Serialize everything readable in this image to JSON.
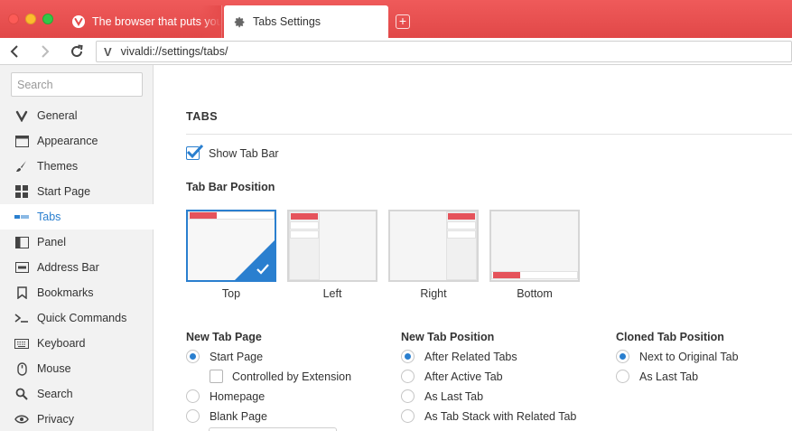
{
  "window": {
    "tabs": [
      {
        "title": "The browser that puts you first",
        "icon": "vivaldi-icon",
        "active": false
      },
      {
        "title": "Tabs Settings",
        "icon": "gear-icon",
        "active": true
      }
    ],
    "new_tab_symbol": "+"
  },
  "addressbar": {
    "url": "vivaldi://settings/tabs/",
    "site_icon": "V"
  },
  "sidebar": {
    "search_placeholder": "Search",
    "items": [
      {
        "label": "General",
        "icon": "vivaldi-icon"
      },
      {
        "label": "Appearance",
        "icon": "window-icon"
      },
      {
        "label": "Themes",
        "icon": "brush-icon"
      },
      {
        "label": "Start Page",
        "icon": "grid-icon"
      },
      {
        "label": "Tabs",
        "icon": "tabs-icon",
        "active": true
      },
      {
        "label": "Panel",
        "icon": "panel-icon"
      },
      {
        "label": "Address Bar",
        "icon": "address-bar-icon"
      },
      {
        "label": "Bookmarks",
        "icon": "bookmark-icon"
      },
      {
        "label": "Quick Commands",
        "icon": "quick-commands-icon"
      },
      {
        "label": "Keyboard",
        "icon": "keyboard-icon"
      },
      {
        "label": "Mouse",
        "icon": "mouse-icon"
      },
      {
        "label": "Search",
        "icon": "search-icon"
      },
      {
        "label": "Privacy",
        "icon": "eye-icon"
      }
    ]
  },
  "content": {
    "section_title": "TABS",
    "show_tab_bar": {
      "label": "Show Tab Bar",
      "checked": true
    },
    "tab_bar_position": {
      "title": "Tab Bar Position",
      "options": [
        {
          "label": "Top",
          "selected": true
        },
        {
          "label": "Left",
          "selected": false
        },
        {
          "label": "Right",
          "selected": false
        },
        {
          "label": "Bottom",
          "selected": false
        }
      ]
    },
    "new_tab_page": {
      "title": "New Tab Page",
      "start_page": {
        "label": "Start Page",
        "selected": true
      },
      "controlled_by_extension": {
        "label": "Controlled by Extension",
        "checked": false
      },
      "homepage": {
        "label": "Homepage",
        "selected": false
      },
      "blank_page": {
        "label": "Blank Page",
        "selected": false
      }
    },
    "new_tab_position": {
      "title": "New Tab Position",
      "options": [
        {
          "label": "After Related Tabs",
          "selected": true
        },
        {
          "label": "After Active Tab",
          "selected": false
        },
        {
          "label": "As Last Tab",
          "selected": false
        },
        {
          "label": "As Tab Stack with Related Tab",
          "selected": false
        }
      ]
    },
    "cloned_tab_position": {
      "title": "Cloned Tab Position",
      "options": [
        {
          "label": "Next to Original Tab",
          "selected": true
        },
        {
          "label": "As Last Tab",
          "selected": false
        }
      ]
    }
  },
  "colors": {
    "accent": "#2a7fcf",
    "titlebar": "#e54b4b",
    "mini_tab": "#e5535b"
  }
}
